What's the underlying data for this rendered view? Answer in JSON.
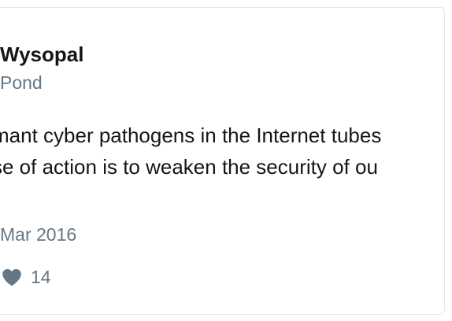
{
  "tweet": {
    "author_name": "Wysopal",
    "author_handle": "Pond",
    "text_lines": [
      "mant cyber pathogens in the Internet tubes",
      "se of action is to weaken the security of ou"
    ],
    "timestamp": "Mar 2016",
    "like_count": "14",
    "like_icon": "heart-icon"
  },
  "colors": {
    "text_primary": "#14171a",
    "text_secondary": "#657786",
    "border": "#e1e8ed"
  }
}
